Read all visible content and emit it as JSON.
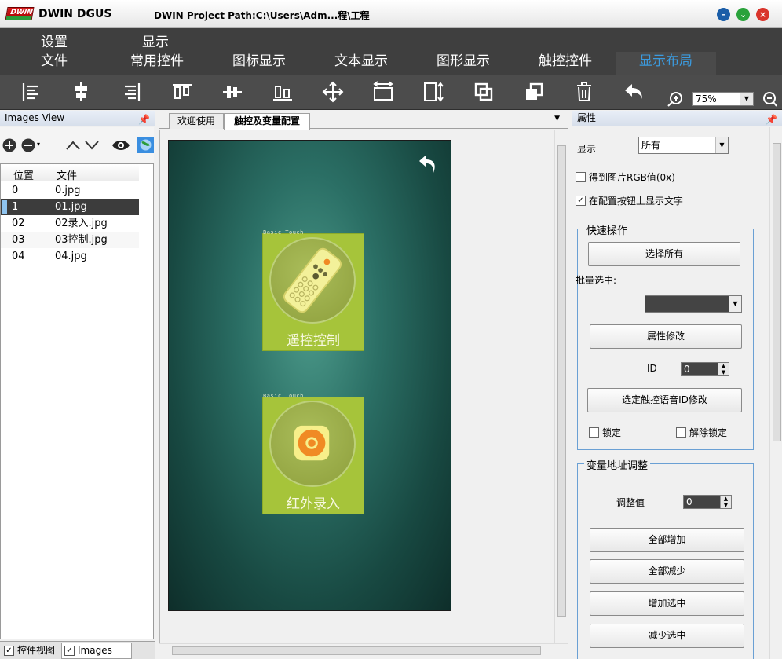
{
  "window": {
    "app_name": "DWIN DGUS",
    "project_path": "DWIN Project Path:C:\\Users\\Adm...程\\工程",
    "logo_text": "DWIN"
  },
  "menu": {
    "row1": [
      "设置",
      "显示"
    ],
    "tabs": [
      "文件",
      "常用控件",
      "图标显示",
      "文本显示",
      "图形显示",
      "触控控件",
      "显示布局"
    ],
    "active_tab": "显示布局"
  },
  "toolbar": {
    "tools": [
      "align-left-icon",
      "align-center-icon",
      "align-right-icon",
      "align-top-icon",
      "align-middle-icon",
      "align-bottom-icon",
      "center-move-icon",
      "same-width-icon",
      "same-height-icon",
      "bring-front-icon",
      "send-back-icon",
      "delete-icon",
      "undo-icon"
    ],
    "zoom_value": "75%"
  },
  "images_view": {
    "title": "Images View",
    "columns": [
      "位置",
      "文件"
    ],
    "rows": [
      {
        "pos": "0",
        "file": "0.jpg"
      },
      {
        "pos": "1",
        "file": "01.jpg"
      },
      {
        "pos": "02",
        "file": "02录入.jpg"
      },
      {
        "pos": "03",
        "file": "03控制.jpg"
      },
      {
        "pos": "04",
        "file": "04.jpg"
      }
    ],
    "selected_index": 1,
    "bottom_tabs": [
      "控件视图",
      "Images View"
    ]
  },
  "document": {
    "tabs": [
      "欢迎使用",
      "触控及变量配置"
    ],
    "active_tab": "触控及变量配置",
    "screen": {
      "buttons": [
        {
          "tag": "Basic Touch",
          "label": "遥控控制"
        },
        {
          "tag": "Basic Touch",
          "label": "红外录入"
        }
      ]
    }
  },
  "properties": {
    "title": "属性",
    "display_label": "显示",
    "display_value": "所有",
    "rgb_check": "得到图片RGB值(0x)",
    "rgb_checked": false,
    "show_text_check": "在配置按钮上显示文字",
    "show_text_checked": true,
    "quick_ops": {
      "title": "快速操作",
      "select_all": "选择所有",
      "batch_select_label": "批量选中:",
      "attr_modify": "属性修改",
      "id_label": "ID",
      "id_value": "0",
      "voice_id_modify": "选定触控语音ID修改",
      "lock": "锁定",
      "unlock": "解除锁定"
    },
    "var_addr": {
      "title": "变量地址调整",
      "adjust_label": "调整值",
      "adjust_value": "0",
      "increase_all": "全部增加",
      "decrease_all": "全部减少",
      "increase_selected": "增加选中",
      "decrease_selected": "减少选中"
    }
  }
}
